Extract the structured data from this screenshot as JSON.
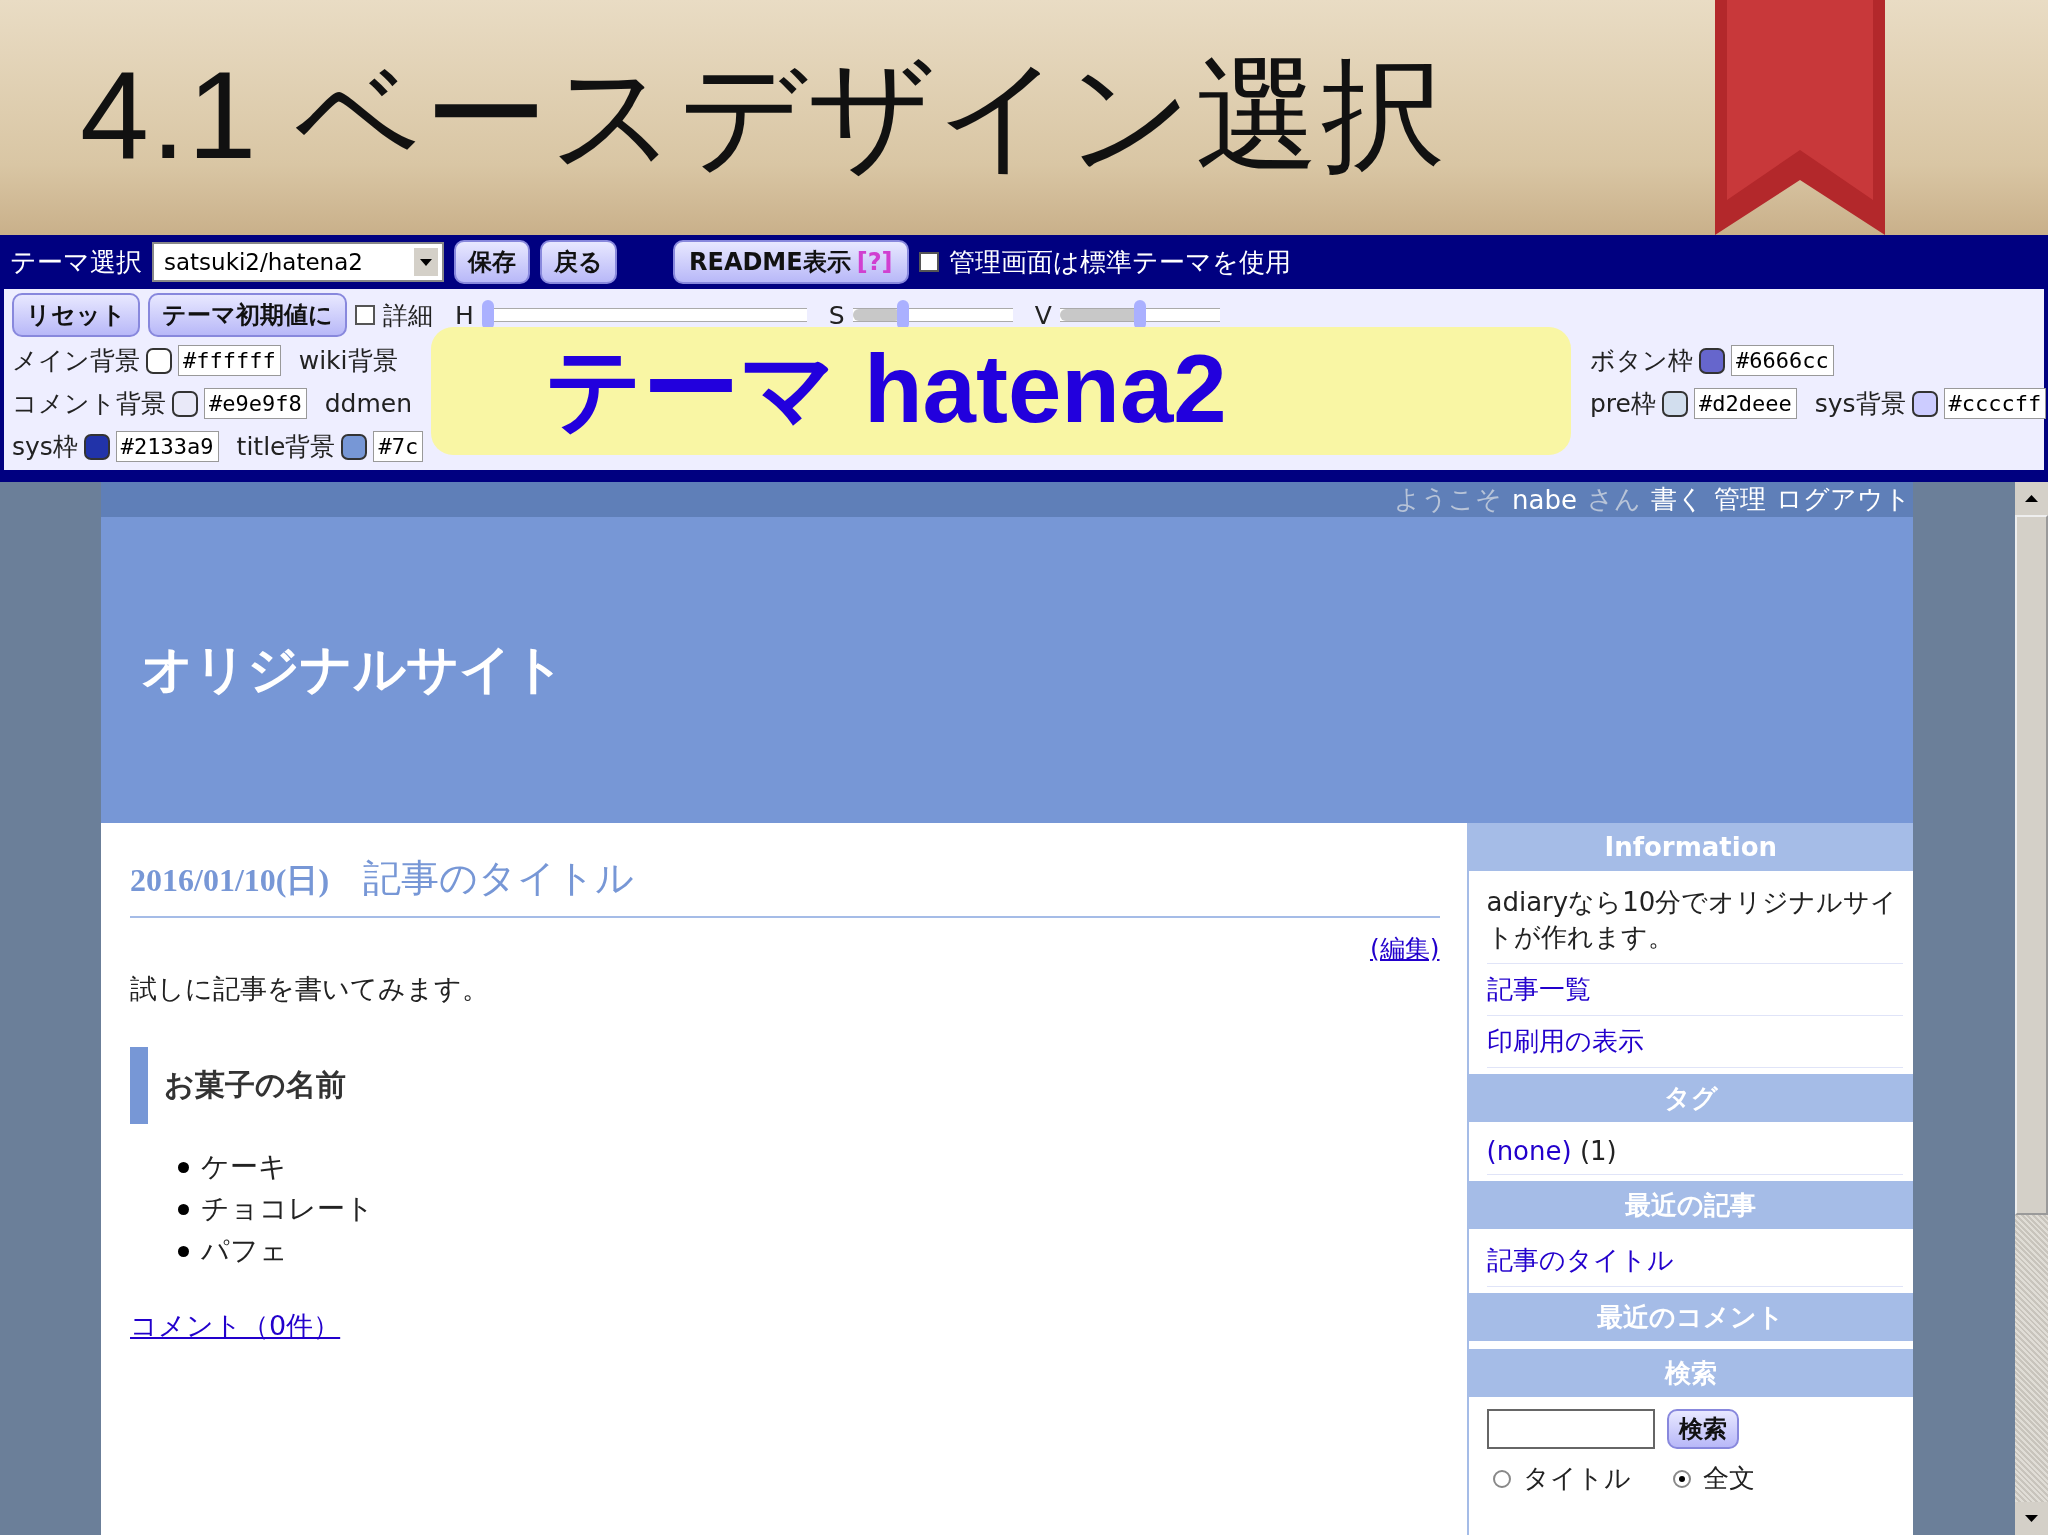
{
  "slide": {
    "title": "4.1 ベースデザイン選択"
  },
  "theme_bar": {
    "label": "テーマ選択",
    "select_value": "satsuki2/hatena2",
    "buttons": [
      "保存",
      "戻る"
    ],
    "readme": {
      "label": "README表示",
      "help": "[?]"
    },
    "admin_option": {
      "label": "管理画面は標準テーマを使用",
      "checked": false
    },
    "buttons_2": [
      "リセット",
      "テーマ初期値に"
    ],
    "detail": {
      "label": "詳細",
      "checked": false
    },
    "sliders": [
      {
        "label": "H",
        "level": 0.0
      },
      {
        "label": "S",
        "level": 0.3
      },
      {
        "label": "V",
        "level": 0.5
      }
    ],
    "color_rows": [
      {
        "left": [
          {
            "label": "メイン背景",
            "color": "#ffffff",
            "value": "#ffffff"
          },
          {
            "label": "wiki背景"
          }
        ],
        "right": [
          {
            "label": "ボタン枠",
            "color": "#6666cc",
            "value": "#6666cc"
          }
        ]
      },
      {
        "left": [
          {
            "label": "コメント背景",
            "color": "#e9e9f8",
            "value": "#e9e9f8"
          },
          {
            "label": "ddmen"
          }
        ],
        "right": [
          {
            "label": "pre枠",
            "color": "#d2deee",
            "value": "#d2deee"
          },
          {
            "label": "sys背景",
            "color": "#ccccff",
            "value": "#ccccff"
          }
        ]
      },
      {
        "left": [
          {
            "label": "sys枠",
            "color": "#2133a9",
            "value": "#2133a9"
          },
          {
            "label": "title背景",
            "color": "#7797d6",
            "value": "#7c"
          }
        ],
        "right": []
      }
    ],
    "callout": "テーマ hatena2"
  },
  "site": {
    "user_bar": [
      {
        "text": "ようこそ",
        "kind": "text"
      },
      {
        "text": "nabe",
        "kind": "name"
      },
      {
        "text": "さん",
        "kind": "text"
      },
      {
        "text": "書く",
        "kind": "link"
      },
      {
        "text": "管理",
        "kind": "link"
      },
      {
        "text": "ログアウト",
        "kind": "link"
      }
    ],
    "site_title": "オリジナルサイト",
    "article": {
      "date": "2016/01/10(日)",
      "title": "記事のタイトル",
      "edit_link": "(編集)",
      "body": "試しに記事を書いてみます。",
      "heading": "お菓子の名前",
      "list": [
        "ケーキ",
        "チョコレート",
        "パフェ"
      ],
      "comment_link": "コメント（0件）"
    },
    "sidebar": [
      {
        "title": "Information",
        "kind": "info",
        "text": "adiaryなら10分でオリジナルサイトが作れます。",
        "links": [
          "記事一覧",
          "印刷用の表示"
        ]
      },
      {
        "title": "タグ",
        "kind": "tags",
        "tag": "(none)",
        "count": "(1)"
      },
      {
        "title": "最近の記事",
        "kind": "links",
        "links": [
          "記事のタイトル"
        ]
      },
      {
        "title": "最近のコメント",
        "kind": "empty"
      },
      {
        "title": "検索",
        "kind": "search",
        "button": "検索",
        "options": [
          {
            "label": "タイトル",
            "selected": false
          },
          {
            "label": "全文",
            "selected": true
          }
        ]
      }
    ]
  }
}
